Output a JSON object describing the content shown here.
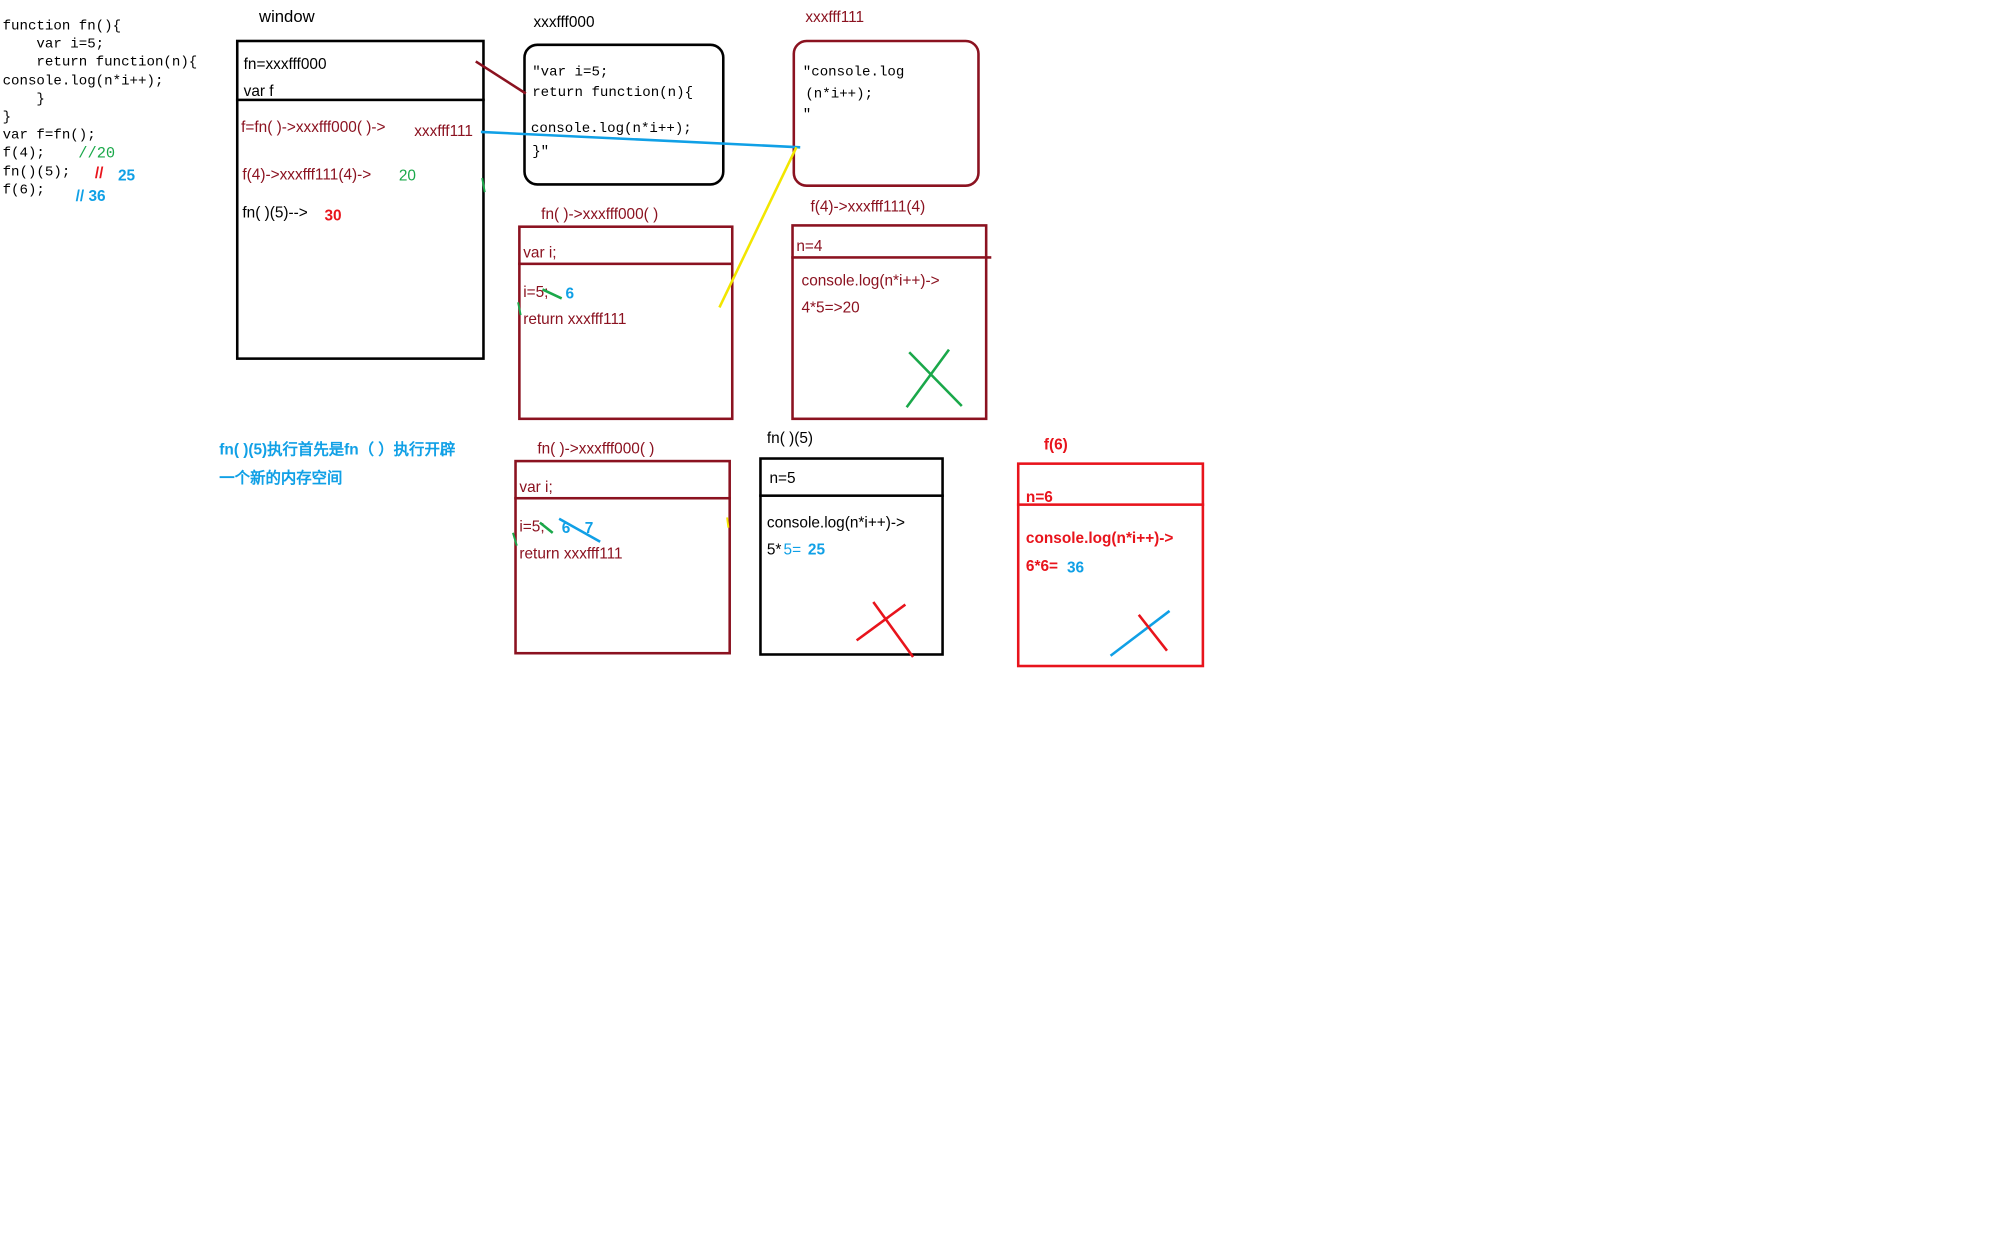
{
  "code": {
    "lines": [
      "function fn(){",
      "    var i=5;",
      "    return function(n){",
      "console.log(n*i++);",
      "    }",
      "}",
      "var f=fn();",
      "f(4);",
      "fn()(5);",
      "f(6);"
    ],
    "comment1": "//20",
    "comment2_slashes": "//",
    "comment2_value": "25",
    "comment3": "// 36"
  },
  "window": {
    "title": "window",
    "row1": "fn=xxxfff000",
    "row2": "var f",
    "line1": "f=fn( )->xxxfff000( )->",
    "line1_ref": "xxxfff111",
    "line2": "f(4)->xxxfff111(4)->",
    "line2_result": "20",
    "line3": "fn( )(5)-->",
    "line3_result": "30"
  },
  "heap0": {
    "title": "xxxfff000",
    "lines": [
      "\"var i=5;",
      "return function(n){",
      "",
      "console.log(n*i++);",
      "}\""
    ]
  },
  "heap1": {
    "title": "xxxfff111",
    "lines": [
      "\"console.log",
      "(n*i++);",
      "\""
    ]
  },
  "scope1": {
    "title": "fn( )->xxxfff000( )",
    "header": "var i;",
    "line1": "i=5;",
    "line1_new": "6",
    "line2": "return xxxfff111"
  },
  "scope_f4": {
    "title": "f(4)->xxxfff111(4)",
    "header": "n=4",
    "line1": "console.log(n*i++)->",
    "line2": "4*5=>20"
  },
  "note": {
    "line1": "fn( )(5)执行首先是fn（ ）执行开辟",
    "line2": "一个新的内存空间"
  },
  "scope2": {
    "title": "fn( )->xxxfff000( )",
    "header": "var i;",
    "line1": "i=5;",
    "line1_new": "6",
    "line1_new2": "7",
    "line2": "return xxxfff111"
  },
  "scope_fn5": {
    "title": "fn( )(5)",
    "header": "n=5",
    "line1": "console.log(n*i++)->",
    "line2_a": "5*",
    "line2_b": "5=",
    "line2_c": "25"
  },
  "scope_f6": {
    "title": "f(6)",
    "header": "n=6",
    "line1": "console.log(n*i++)->",
    "line2_a": "6*6=",
    "line2_b": "36"
  },
  "colors": {
    "dark_red": "#8b1220",
    "red": "#e8141c",
    "blue": "#10a0e6",
    "green": "#1aa84a",
    "yellow": "#f2e600"
  }
}
